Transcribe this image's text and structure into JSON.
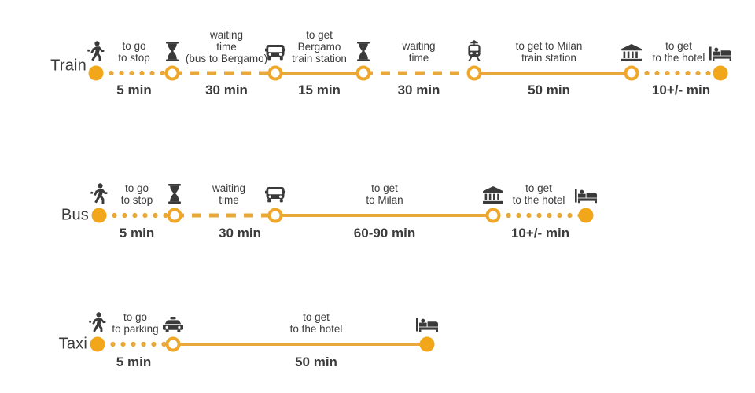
{
  "colors": {
    "accent": "#F2A71B",
    "line": "#E9A93A",
    "node_stroke": "#EFA72A",
    "text": "#3b3b3b",
    "icon": "#3a3a3a",
    "background": "#ffffff"
  },
  "rows": [
    {
      "id": "train",
      "label": "Train",
      "nodes": [
        {
          "name": "node-start-walk",
          "type": "filled",
          "icon": "walking-person-icon"
        },
        {
          "name": "node-bus-stop-wait",
          "type": "hollow",
          "icon": "hourglass-icon"
        },
        {
          "name": "node-bus-to-bergamo",
          "type": "hollow",
          "icon": "bus-icon"
        },
        {
          "name": "node-bergamo-station-wait",
          "type": "hollow",
          "icon": "hourglass-icon"
        },
        {
          "name": "node-train-departure",
          "type": "hollow",
          "icon": "tram-icon"
        },
        {
          "name": "node-milan-station",
          "type": "hollow",
          "icon": "classical-building-icon"
        },
        {
          "name": "node-hotel",
          "type": "filled",
          "icon": "bed-icon"
        }
      ],
      "segments": [
        {
          "name": "segment-walk-to-stop",
          "style": "dotted",
          "caption": "to go\nto stop",
          "duration": "5 min"
        },
        {
          "name": "segment-wait-bus-to-bergamo",
          "style": "dashed",
          "caption": "waiting\ntime\n(bus to Bergamo)",
          "duration": "30 min"
        },
        {
          "name": "segment-bus-to-bergamo-station",
          "style": "solid",
          "caption": "to get\nBergamo\ntrain station",
          "duration": "15 min"
        },
        {
          "name": "segment-wait-train",
          "style": "dashed",
          "caption": "waiting\ntime",
          "duration": "30 min"
        },
        {
          "name": "segment-train-to-milan",
          "style": "solid",
          "caption": "to get to Milan\ntrain station",
          "duration": "50 min"
        },
        {
          "name": "segment-to-hotel",
          "style": "dotted",
          "caption": "to get\nto the hotel",
          "duration": "10+/- min"
        }
      ]
    },
    {
      "id": "bus",
      "label": "Bus",
      "nodes": [
        {
          "name": "node-start-walk",
          "type": "filled",
          "icon": "walking-person-icon"
        },
        {
          "name": "node-bus-stop-wait",
          "type": "hollow",
          "icon": "hourglass-icon"
        },
        {
          "name": "node-bus-departure",
          "type": "hollow",
          "icon": "bus-icon"
        },
        {
          "name": "node-milan-station",
          "type": "hollow",
          "icon": "classical-building-icon"
        },
        {
          "name": "node-hotel",
          "type": "filled",
          "icon": "bed-icon"
        }
      ],
      "segments": [
        {
          "name": "segment-walk-to-stop",
          "style": "dotted",
          "caption": "to go\nto stop",
          "duration": "5 min"
        },
        {
          "name": "segment-wait-bus",
          "style": "dashed",
          "caption": "waiting\ntime",
          "duration": "30 min"
        },
        {
          "name": "segment-bus-to-milan",
          "style": "solid",
          "caption": "to get\nto Milan",
          "duration": "60-90 min"
        },
        {
          "name": "segment-to-hotel",
          "style": "dotted",
          "caption": "to get\nto the hotel",
          "duration": "10+/- min"
        }
      ]
    },
    {
      "id": "taxi",
      "label": "Taxi",
      "nodes": [
        {
          "name": "node-start-walk",
          "type": "filled",
          "icon": "walking-person-icon"
        },
        {
          "name": "node-taxi-parking",
          "type": "hollow",
          "icon": "taxi-icon"
        },
        {
          "name": "node-hotel",
          "type": "filled",
          "icon": "bed-icon"
        }
      ],
      "segments": [
        {
          "name": "segment-walk-to-parking",
          "style": "dotted",
          "caption": "to go\nto parking",
          "duration": "5 min"
        },
        {
          "name": "segment-taxi-to-hotel",
          "style": "solid",
          "caption": "to get\nto the hotel",
          "duration": "50 min"
        }
      ]
    }
  ]
}
